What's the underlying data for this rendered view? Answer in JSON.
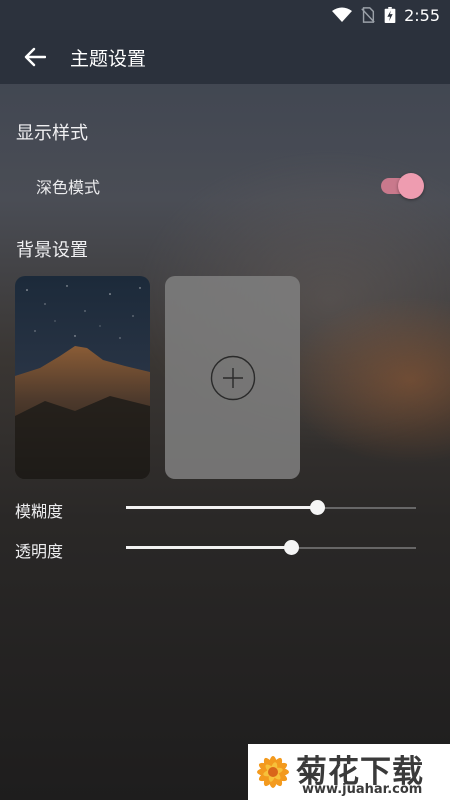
{
  "status_bar": {
    "time": "2:55",
    "icons": [
      "wifi-icon",
      "no-sim-icon",
      "battery-charging-icon"
    ]
  },
  "app_bar": {
    "back_icon": "arrow-left-icon",
    "title": "主题设置"
  },
  "display_section": {
    "title": "显示样式",
    "dark_mode": {
      "label": "深色模式",
      "enabled": true
    }
  },
  "background_section": {
    "title": "背景设置",
    "thumbnail": "mountain-night-sky",
    "add_icon": "plus-circle-icon"
  },
  "sliders": [
    {
      "label": "模糊度",
      "value": 0.66
    },
    {
      "label": "透明度",
      "value": 0.57
    }
  ],
  "watermark": {
    "name": "菊花下载网",
    "url": "www.juahar.com"
  },
  "colors": {
    "accent": "#ee9cb0",
    "app_bar": "#2b313c"
  }
}
